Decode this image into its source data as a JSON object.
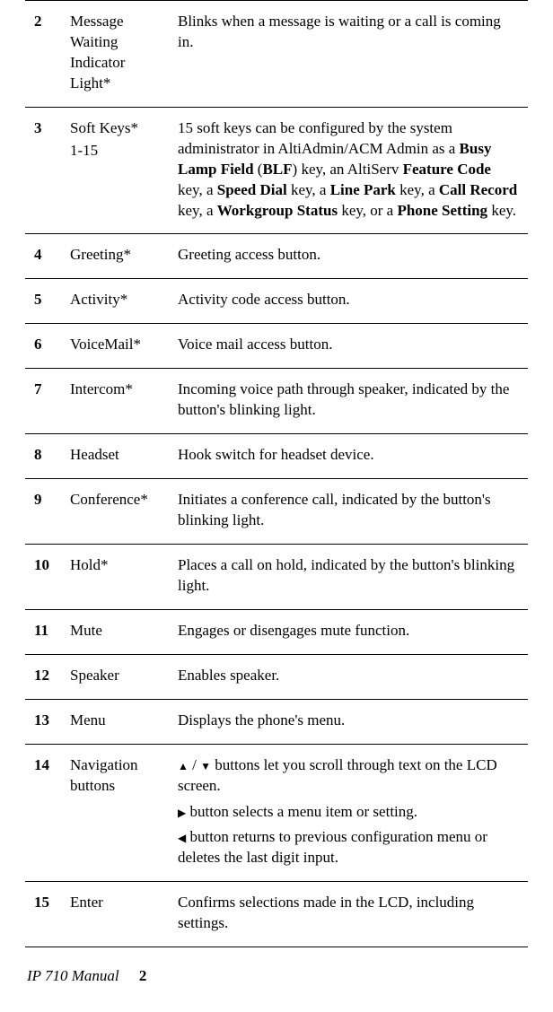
{
  "rows": [
    {
      "num": "2",
      "name": "Message Waiting Indicator Light*",
      "sub": "",
      "desc_plain": "Blinks when a message is waiting or a call is coming in."
    },
    {
      "num": "3",
      "name": "Soft Keys*",
      "sub": "1-15",
      "desc_html": "15 soft keys can be configured by the system administrator in AltiAdmin/ACM Admin as a <span class=\"bold\">Busy Lamp Field</span> (<span class=\"bold\">BLF</span>) key, an AltiServ <span class=\"bold\">Feature Code</span> key, a <span class=\"bold\">Speed Dial</span> key, a <span class=\"bold\">Line Park</span> key, a <span class=\"bold\">Call Record</span> key, a <span class=\"bold\">Workgroup Status</span> key, or a <span class=\"bold\">Phone Setting</span> key."
    },
    {
      "num": "4",
      "name": "Greeting*",
      "sub": "",
      "desc_plain": "Greeting access button."
    },
    {
      "num": "5",
      "name": "Activity*",
      "sub": "",
      "desc_plain": "Activity code access button."
    },
    {
      "num": "6",
      "name": "VoiceMail*",
      "sub": "",
      "desc_plain": "Voice mail access button."
    },
    {
      "num": "7",
      "name": "Intercom*",
      "sub": "",
      "desc_plain": "Incoming voice path through speaker, indicated by the button's blinking light."
    },
    {
      "num": "8",
      "name": "Headset",
      "sub": "",
      "desc_plain": "Hook switch for headset device."
    },
    {
      "num": "9",
      "name": "Conference*",
      "sub": "",
      "desc_plain": "Initiates a conference call, indicated by the button's blinking light."
    },
    {
      "num": "10",
      "name": "Hold*",
      "sub": "",
      "desc_plain": "Places a call on hold, indicated by the button's blinking light."
    },
    {
      "num": "11",
      "name": "Mute",
      "sub": "",
      "desc_plain": "Engages or disengages mute function."
    },
    {
      "num": "12",
      "name": "Speaker",
      "sub": "",
      "desc_plain": "Enables speaker."
    },
    {
      "num": "13",
      "name": "Menu",
      "sub": "",
      "desc_plain": "Displays the phone's menu."
    },
    {
      "num": "14",
      "name": "Navigation buttons",
      "sub": "",
      "desc_html": "<p><span class=\"arrow\">▲</span> / <span class=\"arrow\">▼</span> buttons let you scroll through text on the LCD screen.</p><p><span class=\"arrow\">▶</span> button selects a menu item or setting.</p><p><span class=\"arrow\">◀</span> button returns to previous configuration menu or deletes the last digit input.</p>"
    },
    {
      "num": "15",
      "name": "Enter",
      "sub": "",
      "desc_plain": "Confirms selections made in the LCD, including settings."
    }
  ],
  "footer": {
    "title": "IP 710 Manual",
    "page": "2"
  }
}
